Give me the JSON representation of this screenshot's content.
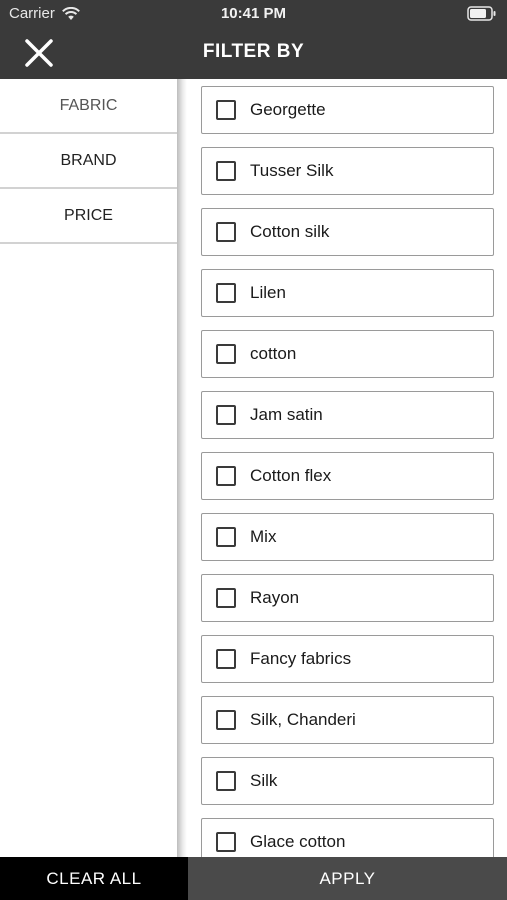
{
  "status_bar": {
    "carrier": "Carrier",
    "time": "10:41 PM",
    "wifi_icon": "wifi-icon",
    "battery_icon": "battery-icon"
  },
  "header": {
    "title": "FILTER BY",
    "close_icon": "close-icon"
  },
  "sidebar": {
    "items": [
      {
        "label": "FABRIC",
        "active": true
      },
      {
        "label": "BRAND",
        "active": false
      },
      {
        "label": "PRICE",
        "active": false
      }
    ]
  },
  "options": [
    {
      "label": "Georgette",
      "checked": false
    },
    {
      "label": "Tusser Silk",
      "checked": false
    },
    {
      "label": "Cotton silk",
      "checked": false
    },
    {
      "label": "Lilen",
      "checked": false
    },
    {
      "label": "cotton",
      "checked": false
    },
    {
      "label": "Jam satin",
      "checked": false
    },
    {
      "label": "Cotton flex",
      "checked": false
    },
    {
      "label": "Mix",
      "checked": false
    },
    {
      "label": "Rayon",
      "checked": false
    },
    {
      "label": "Fancy fabrics",
      "checked": false
    },
    {
      "label": "Silk, Chanderi",
      "checked": false
    },
    {
      "label": "Silk",
      "checked": false
    },
    {
      "label": "Glace cotton",
      "checked": false
    }
  ],
  "footer": {
    "clear_all_label": "CLEAR ALL",
    "apply_label": "APPLY"
  },
  "colors": {
    "header_bg": "#3a3a3a",
    "clear_all_bg": "#000000",
    "apply_bg": "#4a4a4a"
  }
}
